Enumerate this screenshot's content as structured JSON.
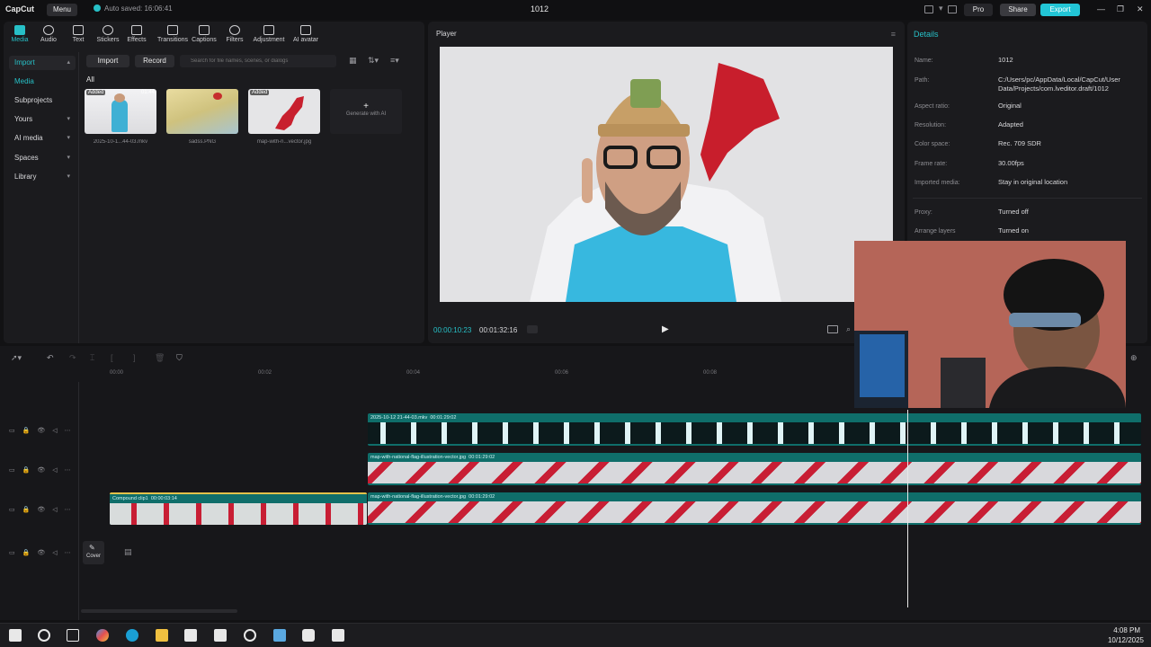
{
  "app": {
    "logo": "CapCut",
    "menu_label": "Menu",
    "autosave": "Auto saved: 16:06:41",
    "project_title": "1012",
    "pro_label": "Pro",
    "share_label": "Share",
    "export_label": "Export",
    "accent_color": "#27c0c7"
  },
  "toolbar": [
    {
      "label": "Media",
      "icon": "media-icon"
    },
    {
      "label": "Audio",
      "icon": "audio-icon"
    },
    {
      "label": "Text",
      "icon": "text-icon"
    },
    {
      "label": "Stickers",
      "icon": "stickers-icon"
    },
    {
      "label": "Effects",
      "icon": "effects-icon"
    },
    {
      "label": "Transitions",
      "icon": "transitions-icon"
    },
    {
      "label": "Captions",
      "icon": "captions-icon"
    },
    {
      "label": "Filters",
      "icon": "filters-icon"
    },
    {
      "label": "Adjustment",
      "icon": "adjustment-icon"
    },
    {
      "label": "AI avatar",
      "icon": "ai-avatar-icon"
    }
  ],
  "side_nav": [
    {
      "label": "Import"
    },
    {
      "label": "Media"
    },
    {
      "label": "Subprojects"
    },
    {
      "label": "Yours"
    },
    {
      "label": "AI media"
    },
    {
      "label": "Spaces"
    },
    {
      "label": "Library"
    }
  ],
  "media": {
    "import_label": "Import",
    "record_label": "Record",
    "search_placeholder": "Search for file names, scenes, or dialogs",
    "all_label": "All",
    "generate_label": "Generate with AI",
    "items": [
      {
        "name": "2025-10-1...44-03.mkv",
        "badge": "Added",
        "duration": "01:44"
      },
      {
        "name": "sadss.PNG",
        "badge": "",
        "duration": ""
      },
      {
        "name": "map-with-n...vector.jpg",
        "badge": "Added",
        "duration": ""
      }
    ]
  },
  "player": {
    "title": "Player",
    "time_current": "00:00:10:23",
    "time_total": "00:01:32:16"
  },
  "details": {
    "title": "Details",
    "rows": [
      {
        "label": "Name:",
        "value": "1012"
      },
      {
        "label": "Path:",
        "value": "C:/Users/pc/AppData/Local/CapCut/User Data/Projects/com.lveditor.draft/1012"
      },
      {
        "label": "Aspect ratio:",
        "value": "Original"
      },
      {
        "label": "Resolution:",
        "value": "Adapted"
      },
      {
        "label": "Color space:",
        "value": "Rec. 709 SDR"
      },
      {
        "label": "Frame rate:",
        "value": "30.00fps"
      },
      {
        "label": "Imported media:",
        "value": "Stay in original location"
      },
      {
        "label": "Proxy:",
        "value": "Turned off"
      },
      {
        "label": "Arrange layers",
        "value": "Turned on"
      }
    ]
  },
  "timeline": {
    "ruler": [
      "00:00",
      "00:02",
      "00:04",
      "00:06",
      "00:08"
    ],
    "cover_label": "Cover",
    "clips": [
      {
        "label": "2025-10-12 21-44-03.mkv",
        "duration": "00:01:29:02"
      },
      {
        "label": "map-with-national-flag-illustration-vector.jpg",
        "duration": "00:01:29:02"
      },
      {
        "label": "Compound clip1",
        "duration": "00:00:03:14"
      },
      {
        "label": "map-with-national-flag-illustration-vector.jpg",
        "duration": "00:01:29:02"
      }
    ]
  },
  "taskbar": {
    "time": "4:08 PM",
    "date": "10/12/2025"
  }
}
